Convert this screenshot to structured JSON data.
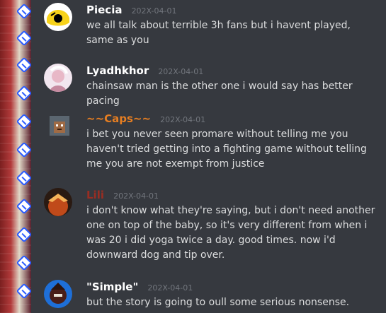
{
  "messages": [
    {
      "author": "Piecia",
      "timestamp": "202X-04-01",
      "text": "we all talk about terrible 3h fans but i havent played, same as you",
      "name_color": "#ffffff"
    },
    {
      "author": "Lyadhkhor",
      "timestamp": "202X-04-01",
      "text": "chainsaw man is the other one i would say has better pacing",
      "name_color": "#ffffff"
    },
    {
      "author": "~~Caps~~",
      "timestamp": "202X-04-01",
      "text": "i bet you never seen promare without telling me you haven't tried getting into a fighting game without telling me you are not exempt from justice",
      "name_color": "#e67e22"
    },
    {
      "author": "Lili",
      "timestamp": "202X-04-01",
      "text": "i don't know what they're saying, but i don't need another one on top of the baby, so it's very different from when i was 20 i did yoga twice a day. good times. now i'd downward dog and tip over.",
      "name_color": "#992d22"
    },
    {
      "author": "\"Simple\"",
      "timestamp": "202X-04-01",
      "text": "but the story is going to oull some serious nonsense.",
      "name_color": "#ffffff"
    }
  ],
  "icons": {
    "sidebar_arrow": "blue-arrow-tile-icon",
    "avatar": "user-avatar-icon"
  }
}
